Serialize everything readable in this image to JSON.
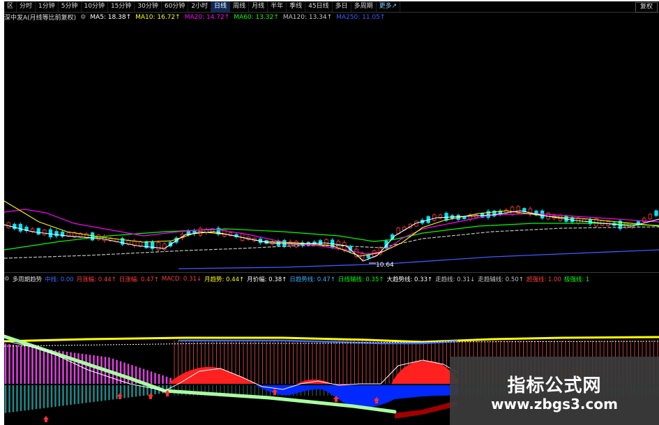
{
  "toolbar": {
    "tabs": [
      "分时",
      "1分钟",
      "5分钟",
      "10分钟",
      "15分钟",
      "30分钟",
      "60分钟",
      "2小时",
      "日线",
      "周线",
      "月线",
      "半年",
      "季线",
      "45日线",
      "多日",
      "多周期",
      "更多↗"
    ],
    "active_tab": "日线",
    "right_button": "复权",
    "corner": "区"
  },
  "ma_legend": {
    "title": "深中发A(月线等比前复权)",
    "items": [
      {
        "label": "MA5: 18.38↑",
        "color": "#ffffff"
      },
      {
        "label": "MA10: 16.72↑",
        "color": "#ffff00"
      },
      {
        "label": "MA20: 14.72↑",
        "color": "#ff00ff"
      },
      {
        "label": "MA60: 13.32↑",
        "color": "#00ff00"
      },
      {
        "label": "MA120: 13.34↑",
        "color": "#c0c0c0"
      },
      {
        "label": "MA250: 11.05↑",
        "color": "#3b5bff"
      }
    ]
  },
  "low_marker": "10.64",
  "indicator_legend": {
    "title": "多周期趋势",
    "items": [
      {
        "label": "中线: 0.00",
        "color": "#3b6bff"
      },
      {
        "label": "月涨幅: 0.44↑",
        "color": "#ff3b3b"
      },
      {
        "label": "日涨幅: 0.47↑",
        "color": "#ff3b3b"
      },
      {
        "label": "MACD: 0.31↓",
        "color": "#ff3b3b"
      },
      {
        "label": "月趋势: 0.44↑",
        "color": "#ffff00"
      },
      {
        "label": "月价幅: 0.38↑",
        "color": "#ffffff"
      },
      {
        "label": "日趋势线: 0.47↑",
        "color": "#3bb0ff"
      },
      {
        "label": "日线辅线: 0.35↑",
        "color": "#00ff00"
      },
      {
        "label": "大趋势线: 0.33↑",
        "color": "#ffffff"
      },
      {
        "label": "走趋线: 0.31↓",
        "color": "#c0c0c0"
      },
      {
        "label": "走趋辅线: 0.50↑",
        "color": "#c0c0c0"
      },
      {
        "label": "超强线: 1.00",
        "color": "#ff3b3b"
      },
      {
        "label": "极强线: 1",
        "color": "#00ff00"
      }
    ]
  },
  "watermark": {
    "title": "指标公式网",
    "url": "www.zbgs3.com"
  },
  "colors": {
    "background": "#000000",
    "up": "#ff3b3b",
    "down": "#00e5ff",
    "ma5": "#ffffff",
    "ma10": "#ffff00",
    "ma20": "#ff00ff",
    "ma60": "#00ff00",
    "ma120": "#c0c0c0",
    "ma250": "#3b5bff"
  }
}
